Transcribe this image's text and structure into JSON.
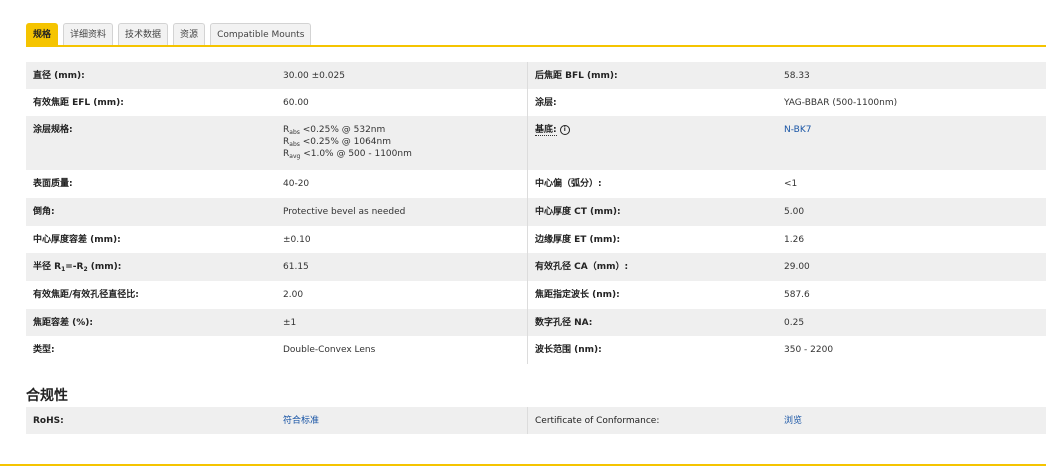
{
  "tabs": [
    "规格",
    "详细资料",
    "技术数据",
    "资源",
    "Compatible Mounts"
  ],
  "specs": [
    {
      "l1": "直径 (mm):",
      "v1": "30.00 ±0.025",
      "l2": "后焦距 BFL (mm):",
      "v2": "58.33"
    },
    {
      "l1": "有效焦距 EFL (mm):",
      "v1": "60.00",
      "l2": "涂层:",
      "v2": "YAG-BBAR (500-1100nm)"
    },
    {
      "l1": "涂层规格:",
      "coating": [
        "<0.25% @ 532nm",
        "<0.25% @ 1064nm",
        "<1.0% @ 500 - 1100nm"
      ],
      "coating_sub": [
        "abs",
        "abs",
        "avg"
      ],
      "coating_r": "R",
      "l2": "基底:",
      "v2": "N-BK7"
    },
    {
      "l1": "表面质量:",
      "v1": "40-20",
      "l2": "中心偏（弧分）:",
      "v2": "<1"
    },
    {
      "l1": "倒角:",
      "v1": "Protective bevel as needed",
      "l2": "中心厚度 CT (mm):",
      "v2": "5.00"
    },
    {
      "l1": "中心厚度容差 (mm):",
      "v1": "±0.10",
      "l2": "边缘厚度 ET (mm):",
      "v2": "1.26"
    },
    {
      "l1_pre": "半径 R",
      "l1_s1": "1",
      "l1_mid": "=-R",
      "l1_s2": "2",
      "l1_post": " (mm):",
      "v1": "61.15",
      "l2": "有效孔径 CA（mm）:",
      "v2": "29.00"
    },
    {
      "l1": "有效焦距/有效孔径直径比:",
      "v1": "2.00",
      "l2": "焦距指定波长 (nm):",
      "v2": "587.6"
    },
    {
      "l1": "焦距容差 (%):",
      "v1": "±1",
      "l2": "数字孔径 NA:",
      "v2": "0.25"
    },
    {
      "l1": "类型:",
      "v1": "Double-Convex Lens",
      "l2": "波长范围 (nm):",
      "v2": "350 - 2200"
    }
  ],
  "compliance": {
    "title": "合规性",
    "rohs_label": "RoHS:",
    "rohs_value": "符合标准",
    "coc_label": "Certificate of Conformance:",
    "coc_value": "浏览"
  }
}
